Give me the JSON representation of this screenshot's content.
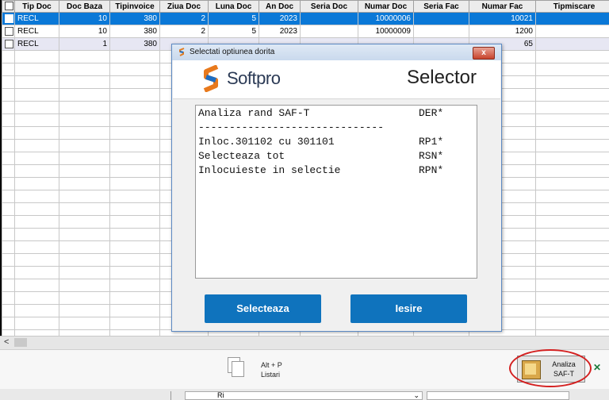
{
  "grid": {
    "columns": [
      "",
      "Tip Doc",
      "Doc Baza",
      "Tipinvoice",
      "Ziua Doc",
      "Luna Doc",
      "An Doc",
      "Seria Doc",
      "Numar Doc",
      "Seria Fac",
      "Numar Fac",
      "Tipmiscare"
    ],
    "rows": [
      [
        "RECL",
        "10",
        "380",
        "2",
        "5",
        "2023",
        "",
        "10000006",
        "",
        "10021",
        ""
      ],
      [
        "RECL",
        "10",
        "380",
        "2",
        "5",
        "2023",
        "",
        "10000009",
        "",
        "1200",
        ""
      ],
      [
        "RECL",
        "1",
        "380",
        "",
        "",
        "",
        "",
        "",
        "",
        "65",
        ""
      ]
    ],
    "selected_row": 0
  },
  "toolbar": {
    "listari_shortcut": "Alt + P",
    "listari_label": "Listari",
    "saft_label_line1": "Analiza",
    "saft_label_line2": "SAF-T"
  },
  "dialog": {
    "title": "Selectati optiunea dorita",
    "close_label": "x",
    "brand_name": "Softpro",
    "header_title": "Selector",
    "options": [
      {
        "label": "Analiza rand SAF-T",
        "code": "DER*"
      },
      {
        "label": "------------------------------",
        "code": ""
      },
      {
        "label": "Inloc.301102 cu 301101",
        "code": "RP1*"
      },
      {
        "label": "Selecteaza tot",
        "code": "RSN*"
      },
      {
        "label": "Inlocuieste in selectie",
        "code": "RPN*"
      }
    ],
    "select_button": "Selecteaza",
    "exit_button": "Iesire"
  },
  "bottom": {
    "combo_value": "Ri"
  },
  "colors": {
    "selected_row": "#0a78d7",
    "alt_row": "#e7e7f3",
    "button_blue": "#0f73bd",
    "highlight_circle": "#d42020"
  }
}
